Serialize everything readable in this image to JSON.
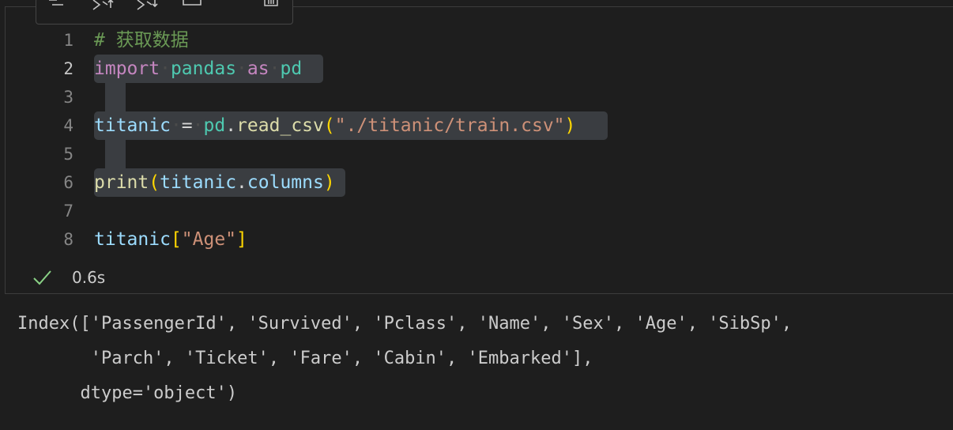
{
  "status": {
    "duration": "0.6s"
  },
  "code_lines": [
    {
      "number": "1",
      "text": "# 获取数据"
    },
    {
      "number": "2",
      "text": "import pandas as pd"
    },
    {
      "number": "3",
      "text": ""
    },
    {
      "number": "4",
      "text": "titanic = pd.read_csv(\"./titanic/train.csv\")"
    },
    {
      "number": "5",
      "text": ""
    },
    {
      "number": "6",
      "text": "print(titanic.columns)"
    },
    {
      "number": "7",
      "text": ""
    },
    {
      "number": "8",
      "text": "titanic[\"Age\"]"
    }
  ],
  "tokens": {
    "l1_comment": "# 获取数据",
    "l2_import": "import",
    "l2_pandas": "pandas",
    "l2_as": "as",
    "l2_pd": "pd",
    "l4_titanic": "titanic",
    "l4_eq": "=",
    "l4_pd": "pd",
    "l4_dot": ".",
    "l4_fn": "read_csv",
    "l4_open": "(",
    "l4_str": "\"./titanic/train.csv\"",
    "l4_close": ")",
    "l6_fn": "print",
    "l6_open": "(",
    "l6_titanic": "titanic",
    "l6_dot": ".",
    "l6_columns": "columns",
    "l6_close": ")",
    "l8_titanic": "titanic",
    "l8_open": "[",
    "l8_str": "\"Age\"",
    "l8_close": "]"
  },
  "output": {
    "lines": [
      "Index(['PassengerId', 'Survived', 'Pclass', 'Name', 'Sex', 'Age', 'SibSp',",
      "       'Parch', 'Ticket', 'Fare', 'Cabin', 'Embarked'],",
      "      dtype='object')"
    ]
  },
  "colors": {
    "background": "#1e1e1e",
    "selection": "#3a3d41",
    "comment": "#6a9955",
    "keyword": "#c586c0",
    "module": "#4ec9b0",
    "variable": "#9cdcfe",
    "function": "#dcdcaa",
    "string": "#ce9178",
    "bracket": "#ffd700",
    "success_check": "#89d185"
  },
  "icons": [
    "run-by-line-icon",
    "execute-above-icon",
    "execute-below-icon",
    "split-cell-icon",
    "delete-cell-icon",
    "success-check-icon"
  ]
}
